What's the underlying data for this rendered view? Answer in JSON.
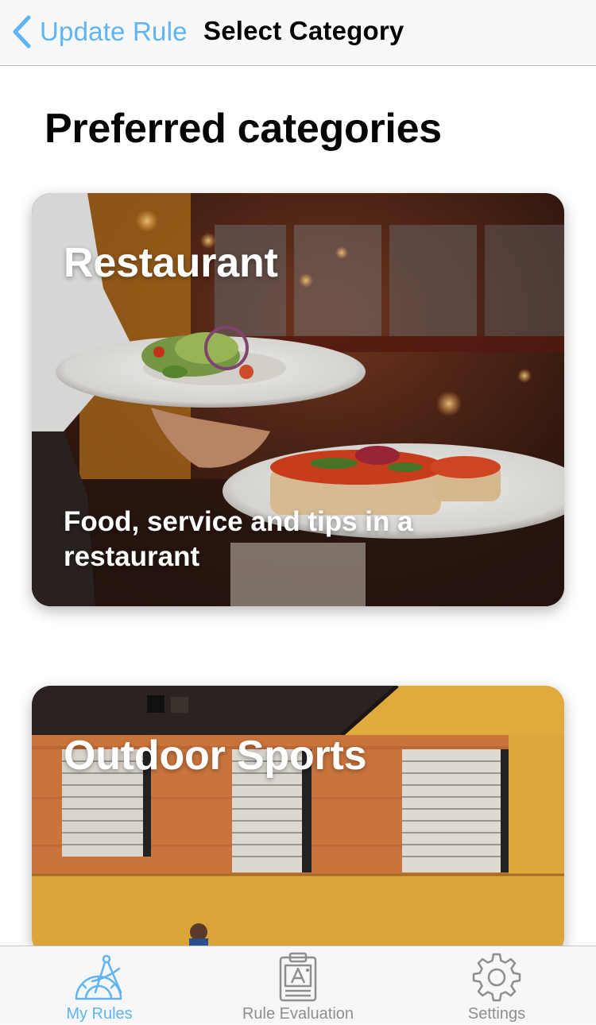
{
  "navbar": {
    "back_label": "Update Rule",
    "title": "Select Category"
  },
  "page": {
    "heading": "Preferred categories"
  },
  "categories": [
    {
      "title": "Restaurant",
      "description": "Food, service and tips in a restaurant",
      "image": "restaurant-photo"
    },
    {
      "title": "Outdoor Sports",
      "description": "",
      "image": "outdoor-sports-photo"
    }
  ],
  "tabbar": {
    "tabs": [
      {
        "label": "My Rules",
        "icon": "compass-ruler-icon",
        "active": true
      },
      {
        "label": "Rule Evaluation",
        "icon": "clipboard-grade-icon",
        "active": false
      },
      {
        "label": "Settings",
        "icon": "gear-icon",
        "active": false
      }
    ]
  },
  "colors": {
    "accent": "#5eb4f4",
    "inactive": "#8e8e8e",
    "navbar_bg": "#f8f8f8"
  }
}
